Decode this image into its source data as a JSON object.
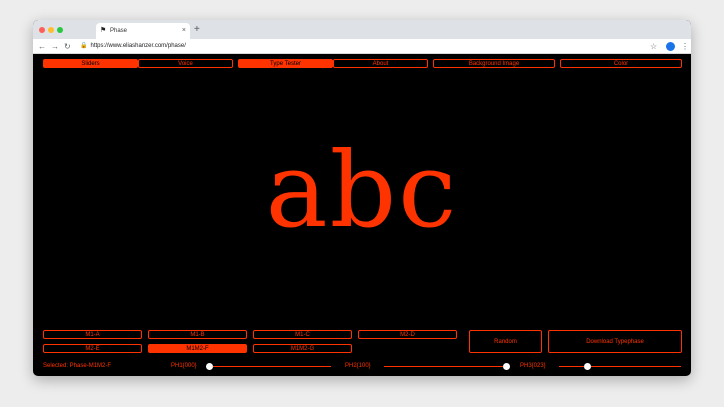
{
  "browser": {
    "tab_title": "Phase",
    "tab_favicon": "⚑",
    "tab_close": "×",
    "new_tab": "+",
    "url": "https://www.eliashanzer.com/phase/",
    "nav_back": "←",
    "nav_forward": "→",
    "nav_reload": "↻",
    "lock": "🔒",
    "star": "☆",
    "menu": "⋮"
  },
  "colors": {
    "accent": "#ff3300",
    "background": "#000000"
  },
  "top_nav": {
    "sliders": "Sliders",
    "voice": "Voice",
    "type_tester": "Type Tester",
    "about": "About",
    "background_image": "Background Image",
    "color": "Color"
  },
  "specimen": "abc",
  "presets": [
    "M1-A",
    "M1-B",
    "M1-C",
    "M2-D",
    "M2-E",
    "M1M2-F",
    "M1M2-G"
  ],
  "selected_preset": "M1M2-F",
  "actions": {
    "random": "Random",
    "download": "Download Typephase"
  },
  "status": {
    "selected": "Selected: Phase-M1M2-F",
    "ph1": "PH1{000}",
    "ph2": "PH2{100}",
    "ph3": "PH3{023}"
  },
  "sliders": {
    "ph1": 0.0,
    "ph2": 1.0,
    "ph3": 0.23
  }
}
